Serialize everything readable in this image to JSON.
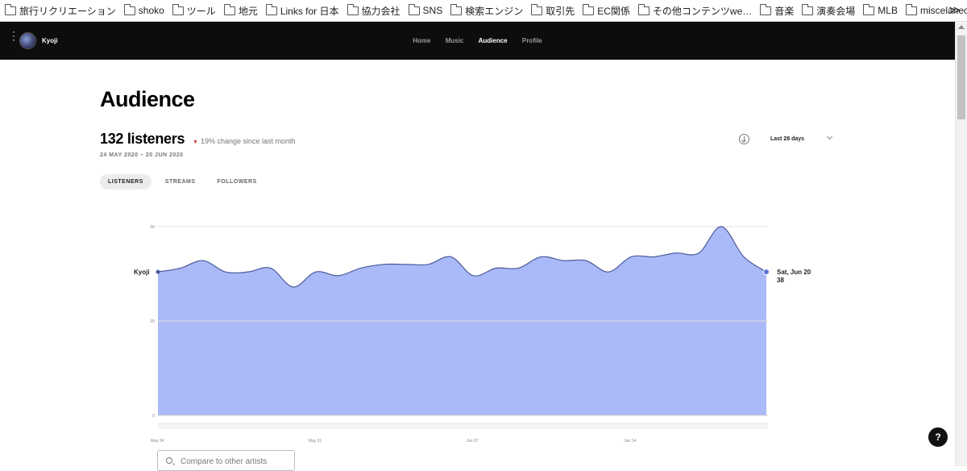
{
  "bookmarks": {
    "items": [
      "旅行リクリエーション",
      "shoko",
      "ツール",
      "地元",
      "Links for 日本",
      "協力会社",
      "SNS",
      "検索エンジン",
      "取引先",
      "EC関係",
      "その他コンテンツwe…",
      "音楽",
      "演奏会場",
      "MLB",
      "miscelaneous"
    ],
    "more_label": "≫"
  },
  "nav": {
    "artist_name": "Kyoji",
    "links": [
      "Home",
      "Music",
      "Audience",
      "Profile"
    ],
    "active": "Audience"
  },
  "main": {
    "title": "Audience",
    "listeners_value": "132 listeners",
    "change_text": "19% change since last month",
    "date_range": "24 MAY 2020 – 20 JUN 2020",
    "period_label": "Last 28 days",
    "tabs": [
      "LISTENERS",
      "STREAMS",
      "FOLLOWERS"
    ],
    "active_tab": "LISTENERS",
    "compare_placeholder": "Compare to other artists",
    "help_label": "?"
  },
  "colors": {
    "area_fill": "#aabaf8",
    "line": "#4b5a9a",
    "change_down": "#d0342c",
    "nav_bg": "#0d0d0d"
  },
  "chart_data": {
    "type": "area",
    "series": [
      {
        "name": "Kyoji",
        "values": [
          38,
          39,
          41,
          38,
          38,
          39,
          34,
          38,
          37,
          39,
          40,
          40,
          40,
          42,
          37,
          39,
          39,
          42,
          41,
          41,
          38,
          42,
          42,
          43,
          43,
          50,
          42,
          38
        ]
      }
    ],
    "x_ticks": [
      {
        "label": "May 24",
        "index": 0
      },
      {
        "label": "May 31",
        "index": 7
      },
      {
        "label": "Jun 07",
        "index": 14
      },
      {
        "label": "Jun 14",
        "index": 21
      }
    ],
    "y_ticks": [
      0,
      25,
      50
    ],
    "ylim": [
      0,
      50
    ],
    "tooltip": {
      "label": "Sat, Jun 20",
      "value": "38"
    },
    "grid": true
  }
}
